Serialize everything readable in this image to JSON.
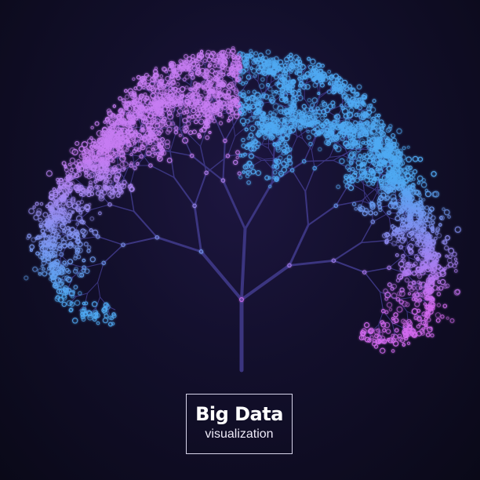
{
  "title": {
    "main": "Big Data",
    "sub": "visualization"
  },
  "colors": {
    "background": "#0b0a1c",
    "branch": "#3b3580",
    "node_purple": "#c67cf2",
    "node_blue": "#4fa9f2",
    "node_magenta": "#d36af0",
    "border": "#d7d4ea"
  }
}
